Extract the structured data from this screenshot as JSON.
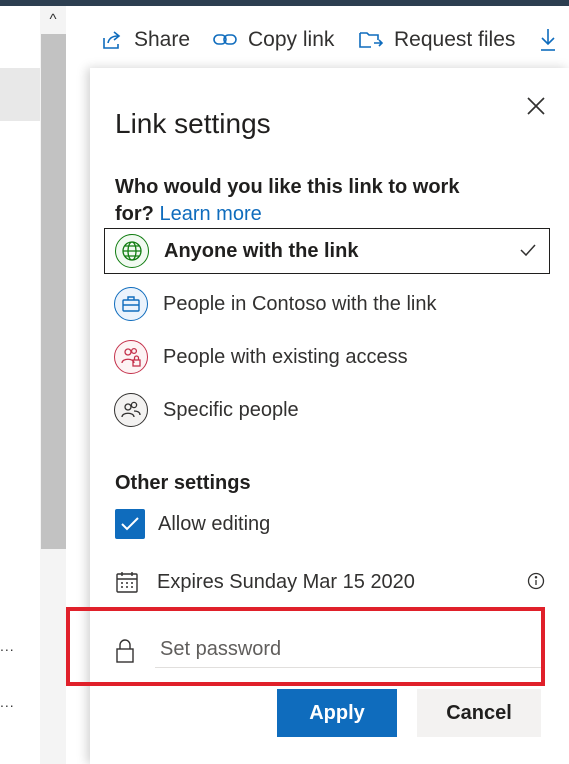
{
  "commandbar": {
    "share_label": "Share",
    "copylink_label": "Copy link",
    "request_label": "Request files"
  },
  "left": {
    "ellipsis_1": "...",
    "ellipsis_2": "..."
  },
  "panel": {
    "title": "Link settings",
    "question": "Who would you like this link to work for?",
    "learn_more": "Learn more",
    "options": [
      {
        "label": "Anyone with the link",
        "icon": "globe-icon",
        "color": "#107c10",
        "selected": true
      },
      {
        "label": "People in Contoso with the link",
        "icon": "briefcase-icon",
        "color": "#0f6cbd",
        "selected": false
      },
      {
        "label": "People with existing access",
        "icon": "people-lock-icon",
        "color": "#c4314b",
        "selected": false
      },
      {
        "label": "Specific people",
        "icon": "people-icon",
        "color": "#323130",
        "selected": false
      }
    ],
    "other_settings": "Other settings",
    "allow_editing": "Allow editing",
    "allow_editing_checked": true,
    "expires": "Expires Sunday Mar 15 2020",
    "password_placeholder": "Set password",
    "password_value": "",
    "apply_label": "Apply",
    "cancel_label": "Cancel"
  },
  "colors": {
    "accent": "#0f6cbd",
    "highlight": "#e0202a"
  }
}
